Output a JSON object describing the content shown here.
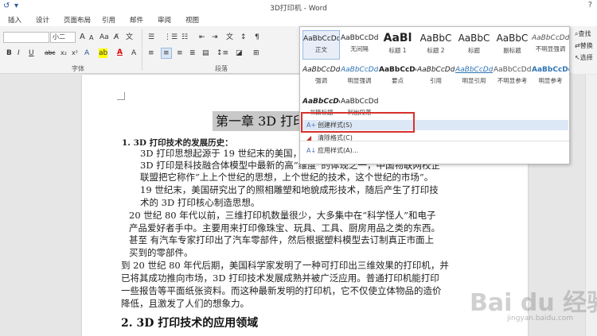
{
  "window": {
    "title": "3D打印机 - Word"
  },
  "tabs": [
    "插入",
    "设计",
    "页面布局",
    "引用",
    "邮件",
    "审阅",
    "视图"
  ],
  "ribbon": {
    "font_size": "小二",
    "group_font": "字体",
    "group_paragraph": "段落",
    "font_buttons": [
      "B",
      "I",
      "U",
      "abc",
      "x₂",
      "x²",
      "A",
      "A"
    ],
    "right_labels": [
      "查找",
      "替换",
      "选择"
    ]
  },
  "styles_gallery": {
    "row1": [
      {
        "preview": "AaBbCcDd",
        "name": "正文",
        "selected": true
      },
      {
        "preview": "AaBbCcDd",
        "name": "无间隔"
      },
      {
        "preview": "AaBl",
        "name": "标题 1"
      },
      {
        "preview": "AaBbC",
        "name": "标题 2"
      },
      {
        "preview": "AaBbC",
        "name": "标题"
      },
      {
        "preview": "AaBbC",
        "name": "副标题"
      },
      {
        "preview": "AaBbCcDd",
        "name": "不明显强调"
      }
    ],
    "row2": [
      {
        "preview": "AaBbCcDd",
        "name": "强调"
      },
      {
        "preview": "AaBbCcDd",
        "name": "明显强调"
      },
      {
        "preview": "AaBbCcDd",
        "name": "要点"
      },
      {
        "preview": "AaBbCcDd",
        "name": "引用"
      },
      {
        "preview": "AaBbCcDd",
        "name": "明显引用"
      },
      {
        "preview": "AaBbCcDd",
        "name": "不明显参考"
      },
      {
        "preview": "AaBbCcDd",
        "name": "明显参考"
      }
    ],
    "row3": [
      {
        "preview": "AaBbCcDd",
        "name": "书籍标题"
      },
      {
        "preview": "AaBbCcDd",
        "name": "列出段落"
      }
    ],
    "menu": [
      "创建样式(S)",
      "清除格式(C)",
      "应用样式(A)..."
    ]
  },
  "document": {
    "chapter": "第一章 3D 打印",
    "item1_title": "1.  3D 打印技术的发展历史：",
    "lines": [
      "3D 打印思想起源于 19 世纪末的美国，并",
      "3D 打印是科技融合体模型中最新的高“维度”的体现之一，中国物联网校企",
      "联盟把它称作“上上个世纪的思想，上个世纪的技术，这个世纪的市场”。",
      "19  世纪末，美国研究出了的照相雕塑和地貌成形技术，随后产生了打印技",
      "术的 3D 打印核心制造思想。",
      "20 世纪 80 年代以前，三维打印机数量很少，大多集中在“科学怪人”和电子",
      "产品爱好者手中。主要用来打印像珠宝、玩具、工具、厨房用品之类的东西。",
      "甚至    有汽车专家打印出了汽车零部件，然后根据塑料模型去订制真正市面上",
      "买到的零部件。",
      "到 20 世纪 80 年代后期，美国科学家发明了一种可打印出三维效果的打印机，并",
      "已将其成功推向市场，3D 打印技术发展成熟并被广泛应用。普通打印机能打印",
      "一些报告等平面纸张资料。而这种最新发明的打印机，它不仅使立体物品的造价",
      "降低，且激发了人们的想象力。"
    ],
    "heading2": "2.   3D 打印技术的应用领域"
  },
  "watermark": {
    "brand": "Bai du 经验",
    "url": "jingyan.baidu.com"
  }
}
